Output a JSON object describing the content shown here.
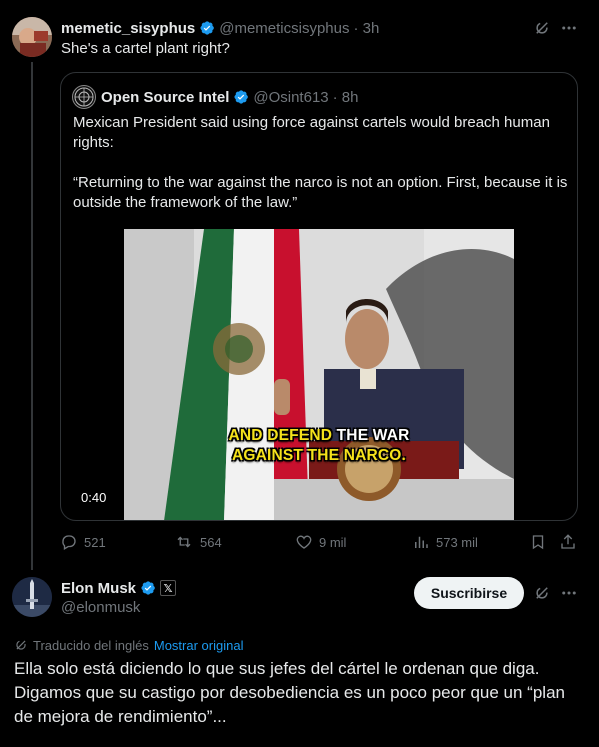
{
  "post1": {
    "display_name": "memetic_sisyphus",
    "handle": "@memeticsisyphus",
    "time": "· 3h",
    "text": "She's a cartel plant right?"
  },
  "quote": {
    "display_name": "Open Source Intel",
    "handle": "@Osint613",
    "time": "· 8h",
    "text1": "Mexican President said using force against cartels would breach human rights:",
    "text2": "“Returning to the war against the narco is not an option. First, because it is outside the framework of the law.”",
    "video": {
      "caption_line1_a": "AND ",
      "caption_line1_b": "DEFEND",
      "caption_line1_c": " THE WAR",
      "caption_line2": "AGAINST THE NARCO.",
      "duration": "0:40"
    }
  },
  "actions": {
    "replies": "521",
    "reposts": "564",
    "likes": "9 mil",
    "views": "573 mil"
  },
  "post2": {
    "display_name": "Elon Musk",
    "handle": "@elonmusk",
    "subscribe_label": "Suscribirse",
    "translated_label": "Traducido del inglés",
    "show_original": "Mostrar original",
    "text": "Ella solo está diciendo lo que sus jefes del cártel le ordenan que diga. Digamos que su castigo por desobediencia es un poco peor que un “plan de mejora de rendimiento”..."
  },
  "colors": {
    "accent": "#1d9bf0",
    "muted": "#71767b",
    "border": "#2f3336",
    "caption_yellow": "#f5e21b"
  }
}
